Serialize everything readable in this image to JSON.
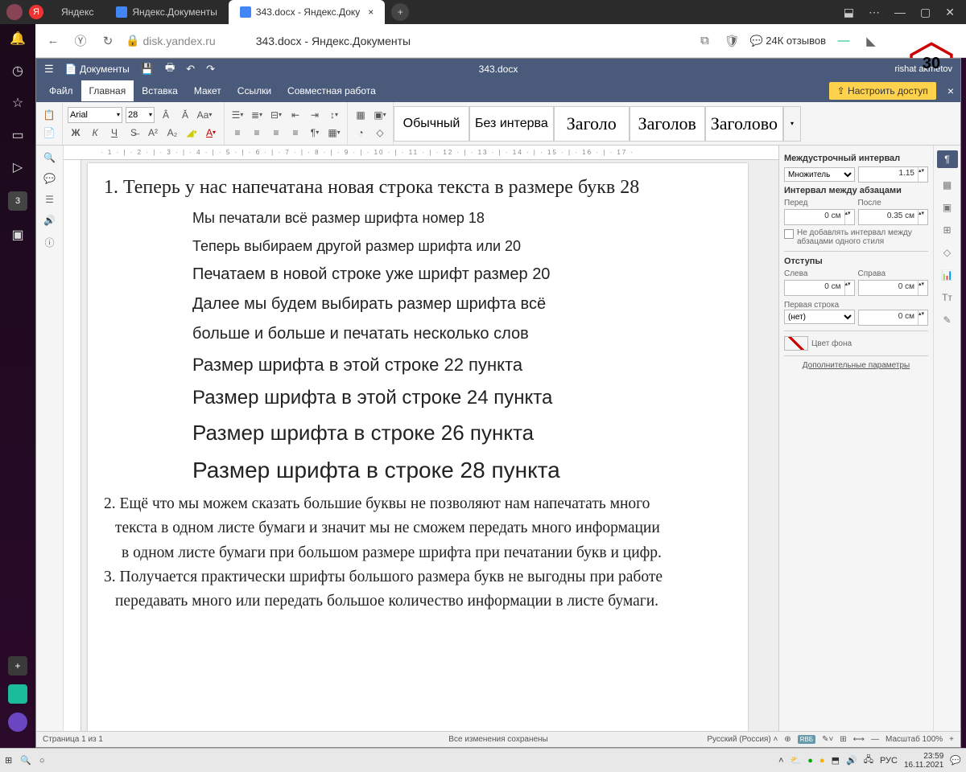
{
  "browser": {
    "tabs": [
      {
        "label": "Яндекс"
      },
      {
        "label": "Яндекс.Документы"
      },
      {
        "label": "343.docx - Яндекс.Доку",
        "active": true
      }
    ],
    "url_host": "disk.yandex.ru",
    "page_title": "343.docx - Яндекс.Документы",
    "reviews": "24К отзывов",
    "hex_badge": "30"
  },
  "app": {
    "brand": "Документы",
    "docname": "343.docx",
    "user": "rishat akmetov",
    "menus": [
      "Файл",
      "Главная",
      "Вставка",
      "Макет",
      "Ссылки",
      "Совместная работа"
    ],
    "share_btn": "Настроить доступ",
    "font_name": "Arial",
    "font_size": "28",
    "styles": [
      "Обычный",
      "Без интерва",
      "Заголо",
      "Заголов",
      "Заголово"
    ],
    "ruler": "· 1 · | · 2 · | · 3 · | · 4 · | · 5 · | · 6 · | · 7 · | · 8 · | · 9 · | · 10 · | · 11 · | · 12 · | · 13 · | · 14 · | · 15 · | · 16 · | · 17 ·"
  },
  "doc": {
    "p1": "1. Теперь у нас напечатана новая строка текста в размере букв 28",
    "l1": "Мы печатали всё размер шрифта номер 18",
    "l2": "Теперь выбираем другой размер шрифта или 20",
    "l3": "Печатаем в новой строке уже шрифт размер 20",
    "l4": "Далее мы будем выбирать размер шрифта всё",
    "l5": "больше и больше и печатать несколько слов",
    "l6": "Размер шрифта в этой строке 22 пункта",
    "l7": "Размер шрифта в этой строке 24 пункта",
    "l8": "Размер шрифта в строке 26 пункта",
    "l9": "Размер шрифта в строке 28 пункта",
    "p2a": "2. Ещё что мы можем сказать большие буквы не позволяют нам напечатать много",
    "p2b": "текста в одном листе бумаги и значит мы не сможем передать много информации",
    "p2c": "в одном листе бумаги при большом размере шрифта при печатании букв и цифр.",
    "p3a": "3. Получается практически шрифты большого размера букв не выгодны при работе",
    "p3b": "передавать много или передать большое количество информации в листе бумаги."
  },
  "panel": {
    "line_spacing_hdr": "Междустрочный интервал",
    "multiplier": "Множитель",
    "multiplier_val": "1.15",
    "para_spacing_hdr": "Интервал между абзацами",
    "before": "Перед",
    "after": "После",
    "before_val": "0 см",
    "after_val": "0.35 см",
    "no_space_same": "Не добавлять интервал между абзацами одного стиля",
    "indents_hdr": "Отступы",
    "left": "Слева",
    "right": "Справа",
    "left_val": "0 см",
    "right_val": "0 см",
    "first_line": "Первая строка",
    "first_line_opt": "(нет)",
    "first_line_val": "0 см",
    "bg_color": "Цвет фона",
    "advanced": "Дополнительные параметры"
  },
  "status": {
    "page": "Страница 1 из 1",
    "saved": "Все изменения сохранены",
    "lang": "Русский (Россия)",
    "zoom": "Масштаб 100%"
  },
  "taskbar": {
    "lang": "РУС",
    "time": "23:59",
    "date": "16.11.2021"
  }
}
